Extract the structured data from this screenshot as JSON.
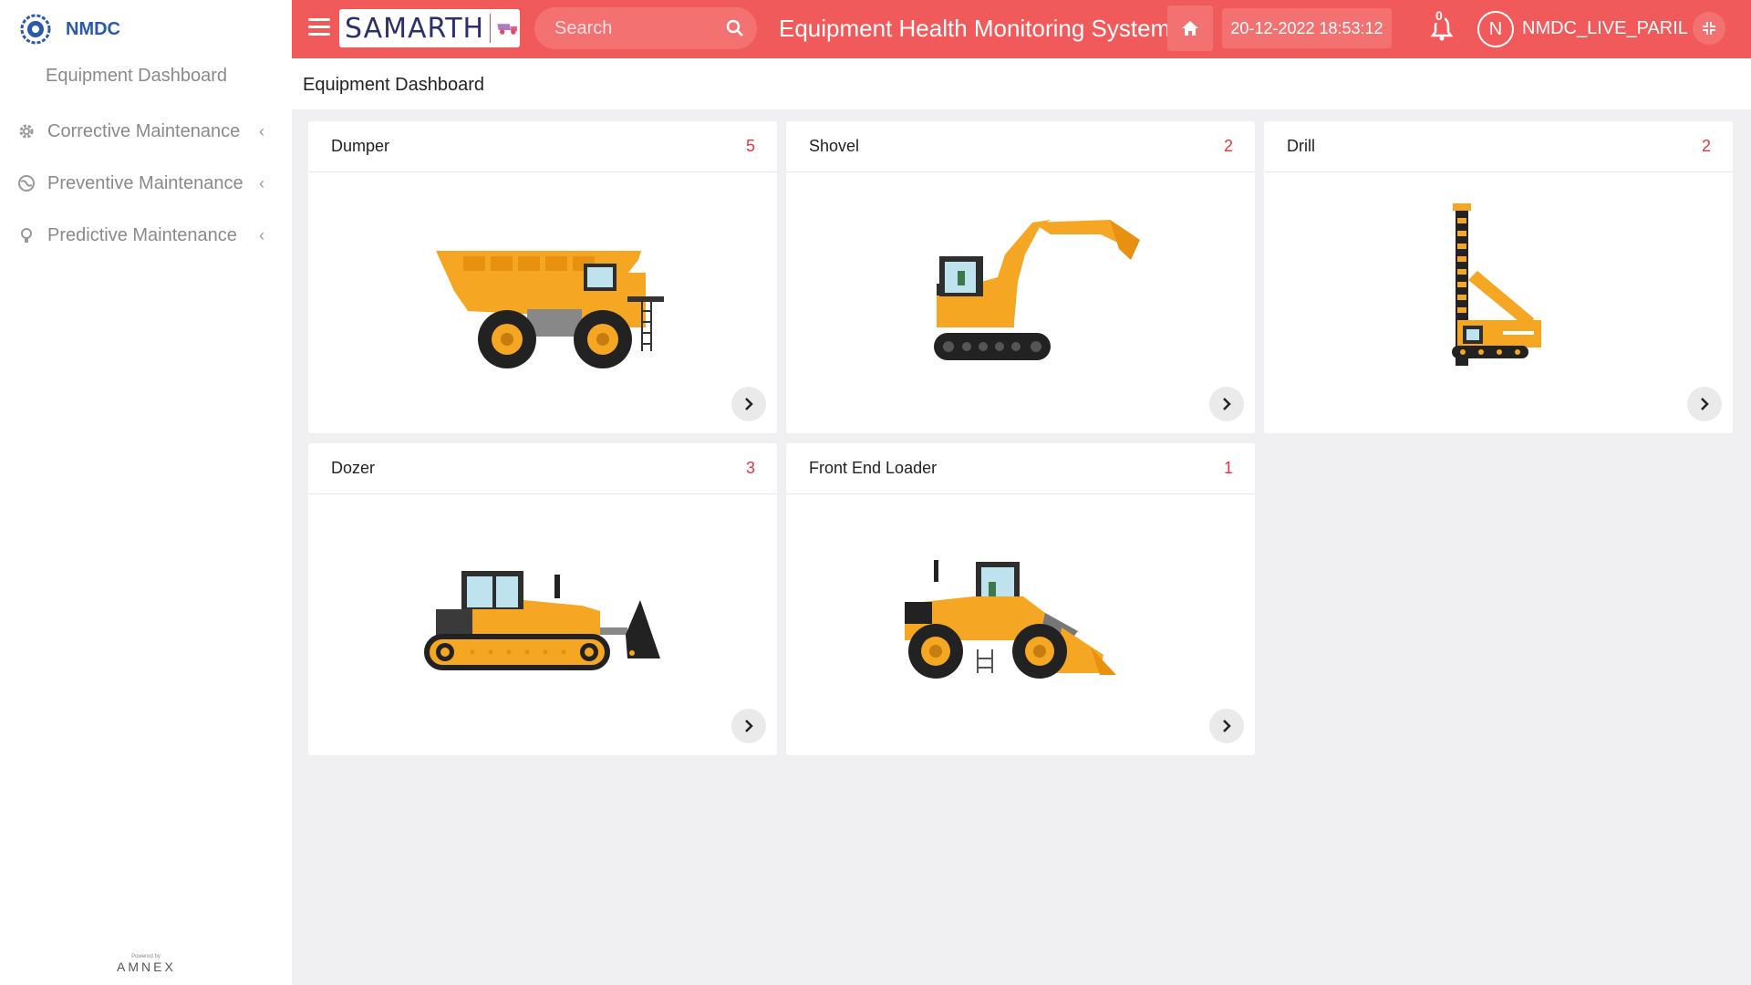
{
  "sidebar": {
    "brand": "NMDC",
    "dashboard_link": "Equipment Dashboard",
    "items": [
      {
        "label": "Corrective Maintenance",
        "icon": "gear-icon"
      },
      {
        "label": "Preventive Maintenance",
        "icon": "globe-icon"
      },
      {
        "label": "Predictive Maintenance",
        "icon": "bulb-icon"
      }
    ],
    "powered_small": "Powered by",
    "powered_brand": "AMNEX"
  },
  "topbar": {
    "logo_text": "SAMARTH",
    "search_placeholder": "Search",
    "app_title": "Equipment Health Monitoring System",
    "datetime": "20-12-2022 18:53:12",
    "notification_count": "0",
    "avatar_initial": "N",
    "username": "NMDC_LIVE_PARIL"
  },
  "page": {
    "title": "Equipment Dashboard"
  },
  "equipment": [
    {
      "name": "Dumper",
      "count": "5",
      "icon": "dumper-truck-image"
    },
    {
      "name": "Shovel",
      "count": "2",
      "icon": "excavator-image"
    },
    {
      "name": "Drill",
      "count": "2",
      "icon": "drill-rig-image"
    },
    {
      "name": "Dozer",
      "count": "3",
      "icon": "bulldozer-image"
    },
    {
      "name": "Front End Loader",
      "count": "1",
      "icon": "wheel-loader-image"
    }
  ],
  "colors": {
    "topbar": "#f15a5a",
    "brand": "#2b5aa7",
    "count": "#e0383e",
    "machine": "#f5a623"
  }
}
